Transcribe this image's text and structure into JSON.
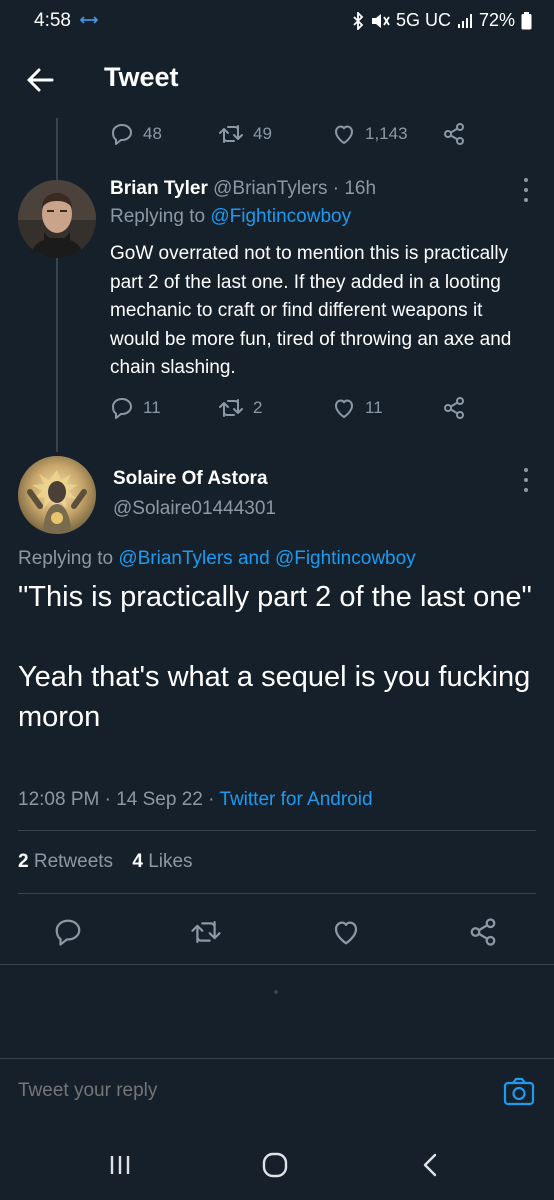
{
  "status_bar": {
    "time": "4:58",
    "network": "5G UC",
    "battery": "72%"
  },
  "header": {
    "title": "Tweet"
  },
  "prev_tweet_stats": {
    "replies": "48",
    "retweets": "49",
    "likes": "1,143"
  },
  "reply_tweet": {
    "name": "Brian Tyler",
    "meta": "@BrianTylers · 16h",
    "replying_prefix": "Replying to ",
    "replying_to": "@Fightincowboy",
    "text": "GoW overrated not to mention this is practically part 2 of the last one. If they added in a looting mechanic to craft or find different weapons it would be more fun, tired of throwing an axe and chain slashing.",
    "replies": "11",
    "retweets": "2",
    "likes": "11"
  },
  "main_tweet": {
    "name": "Solaire Of Astora",
    "handle": "@Solaire01444301",
    "replying_prefix": "Replying to ",
    "replying_to_1": "@BrianTylers",
    "and": " and ",
    "replying_to_2": "@Fightincowboy",
    "text": "\"This is practically part 2 of the last one\"\n\nYeah that's what a sequel is you fucking moron",
    "time": "12:08 PM",
    "date": "14 Sep 22",
    "source": "Twitter for Android",
    "retweets_count": "2",
    "retweets_label": "Retweets",
    "likes_count": "4",
    "likes_label": "Likes"
  },
  "reply_input": {
    "placeholder": "Tweet your reply"
  },
  "colors": {
    "background": "#15202b",
    "accent": "#1d9bf0",
    "muted": "#8b98a5",
    "divider": "#38444d"
  }
}
